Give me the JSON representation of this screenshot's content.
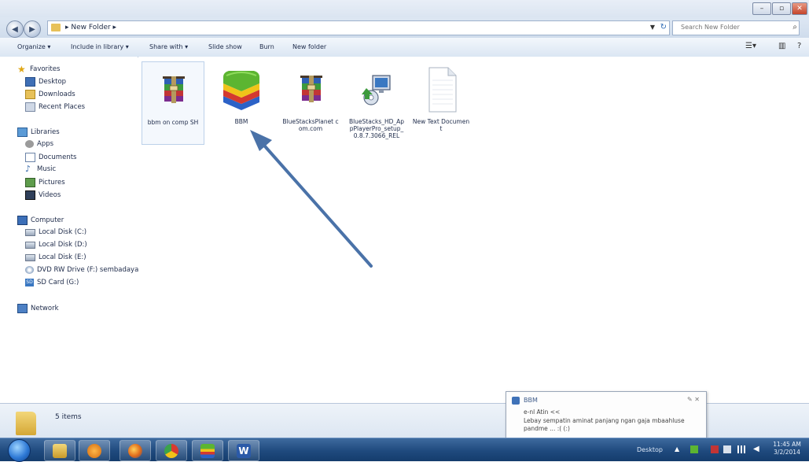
{
  "window": {
    "address": "▸ New Folder ▸",
    "search_placeholder": "Search New Folder"
  },
  "command_bar": {
    "organize": "Organize ▾",
    "include_in_library": "Include in library ▾",
    "share_with": "Share with ▾",
    "slide_show": "Slide show",
    "burn": "Burn",
    "new_folder": "New folder"
  },
  "nav": {
    "favorites": "Favorites",
    "desktop": "Desktop",
    "downloads": "Downloads",
    "recent_places": "Recent Places",
    "libraries": "Libraries",
    "apps": "Apps",
    "documents": "Documents",
    "music": "Music",
    "pictures": "Pictures",
    "videos": "Videos",
    "computer": "Computer",
    "local_disk_c": "Local Disk (C:)",
    "local_disk_d": "Local Disk (D:)",
    "local_disk_e": "Local Disk (E:)",
    "dvd_drive": "DVD RW Drive (F:) sembadaya",
    "sd_card": "SD Card (G:)",
    "network": "Network"
  },
  "files": [
    {
      "name": "bbm on comp SH",
      "icon": "winrar-archive-icon"
    },
    {
      "name": "BBM",
      "icon": "bluestacks-icon"
    },
    {
      "name": "BlueStacksPlanet com.com",
      "icon": "winrar-archive-icon"
    },
    {
      "name": "BlueStacks_HD_AppPlayerPro_setup_0.8.7.3066_REL",
      "icon": "installer-icon"
    },
    {
      "name": "New Text Document",
      "icon": "text-document-icon"
    }
  ],
  "details": {
    "item_count": "5 items"
  },
  "notification": {
    "app": "BBM",
    "sender": "e-nl Atin <<",
    "message": "Lebay sempatin aminat panjang ngan gaja mbaahluse pandme ... :( (:)"
  },
  "taskbar": {
    "desktop_label": "Desktop",
    "time": "11:45 AM",
    "date": "3/2/2014"
  },
  "colors": {
    "taskbar": "#1f4a7e",
    "arrow": "#4a72a8",
    "selection": "#bcd1ea"
  }
}
